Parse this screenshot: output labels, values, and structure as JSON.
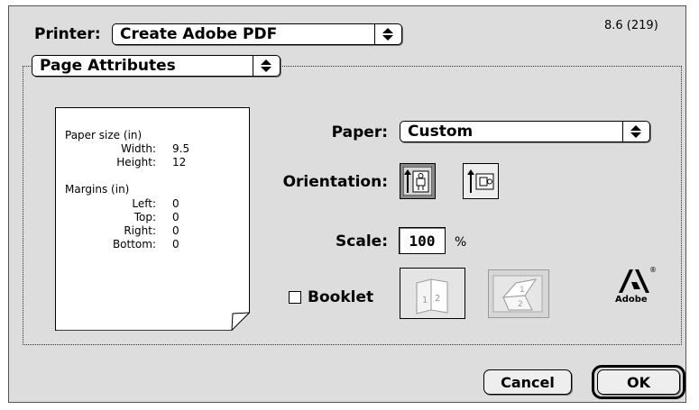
{
  "header": {
    "printer_label": "Printer:",
    "printer_value": "Create Adobe PDF",
    "version": "8.6 (219)"
  },
  "section_popup": {
    "value": "Page Attributes"
  },
  "preview": {
    "paper_size_heading": "Paper size (in)",
    "width_label": "Width:",
    "width_value": "9.5",
    "height_label": "Height:",
    "height_value": "12",
    "margins_heading": "Margins (in)",
    "left_label": "Left:",
    "left_value": "0",
    "top_label": "Top:",
    "top_value": "0",
    "right_label": "Right:",
    "right_value": "0",
    "bottom_label": "Bottom:",
    "bottom_value": "0"
  },
  "settings": {
    "paper_label": "Paper:",
    "paper_value": "Custom",
    "orientation_label": "Orientation:",
    "orientation_selected": "portrait",
    "scale_label": "Scale:",
    "scale_value": "100",
    "scale_unit": "%",
    "booklet_label": "Booklet",
    "booklet_checked": false
  },
  "brand": {
    "name": "Adobe",
    "registered": "®"
  },
  "buttons": {
    "cancel": "Cancel",
    "ok": "OK"
  },
  "icons": {
    "popup_arrows": "up-down-arrows-icon",
    "portrait": "portrait-orientation-icon",
    "landscape": "landscape-orientation-icon",
    "booklet_a": "booklet-book-icon",
    "booklet_b": "booklet-flip-icon",
    "logo": "adobe-logo-icon"
  }
}
